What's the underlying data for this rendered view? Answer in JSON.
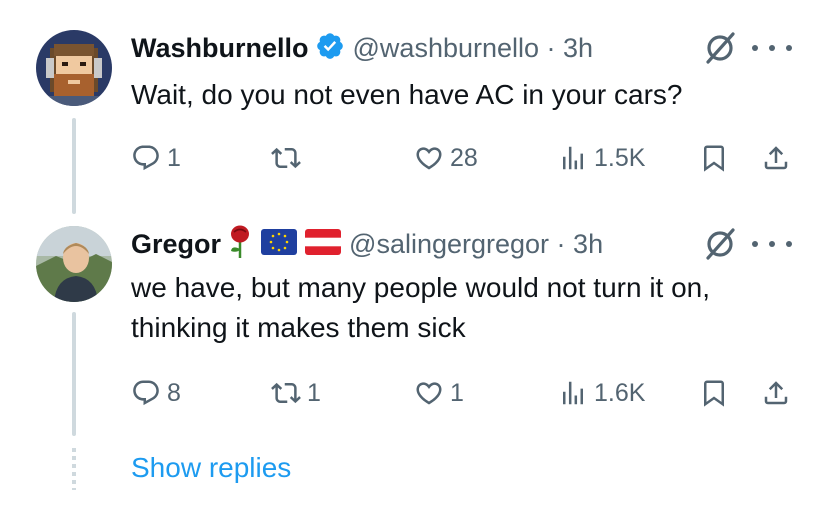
{
  "tweets": [
    {
      "name": "Washburnello",
      "handle": "@washburnello",
      "time": "3h",
      "text_lines": [
        "Wait, do you not even have AC in your cars?"
      ],
      "reply_count": "1",
      "retweet_count": "",
      "like_count": "28",
      "view_count": "1.5K",
      "verified": true
    },
    {
      "name": "Gregor",
      "handle": "@salingergregor",
      "time": "3h",
      "text_lines": [
        "we have, but many people would not turn it on,",
        "thinking it makes them sick"
      ],
      "reply_count": "8",
      "retweet_count": "1",
      "like_count": "1",
      "view_count": "1.6K",
      "emoji_badges": [
        "rose",
        "eu-flag",
        "austria-flag"
      ]
    }
  ],
  "show_replies_label": "Show replies",
  "colors": {
    "accent": "#1d9bf0",
    "secondary_text": "#536471",
    "thread_line": "#cfd9de"
  }
}
